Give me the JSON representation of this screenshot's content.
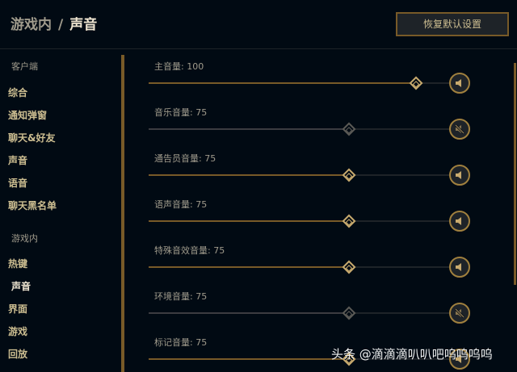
{
  "header": {
    "breadcrumb_parent": "游戏内",
    "breadcrumb_separator": "/",
    "breadcrumb_current": "声音",
    "reset_button": "恢复默认设置"
  },
  "sidebar": {
    "client_section": "客户端",
    "client_items": [
      "综合",
      "通知弹窗",
      "聊天&好友",
      "声音",
      "语音",
      "聊天黑名单"
    ],
    "ingame_section": "游戏内",
    "ingame_items": [
      "热键",
      "声音",
      "界面",
      "游戏",
      "回放"
    ],
    "active_item": "声音"
  },
  "volumes": [
    {
      "label": "主音量: 100",
      "value": 100,
      "muted": false
    },
    {
      "label": "音乐音量: 75",
      "value": 75,
      "muted": true
    },
    {
      "label": "通告员音量: 75",
      "value": 75,
      "muted": false
    },
    {
      "label": "语声音量: 75",
      "value": 75,
      "muted": false
    },
    {
      "label": "特殊音效音量: 75",
      "value": 75,
      "muted": false
    },
    {
      "label": "环境音量: 75",
      "value": 75,
      "muted": true
    },
    {
      "label": "标记音量: 75",
      "value": 75,
      "muted": false
    }
  ],
  "icons": {
    "speaker": "speaker-icon",
    "speaker_muted": "speaker-muted-icon",
    "thumb": "diamond-slider-thumb"
  },
  "colors": {
    "background": "#010a13",
    "gold": "#c8aa6e",
    "gold_dark": "#785a28",
    "text": "#a09b8c",
    "text_bright": "#f0e6d2"
  },
  "watermark": "头条 @滴滴滴叭叭吧呜呜呜呜"
}
